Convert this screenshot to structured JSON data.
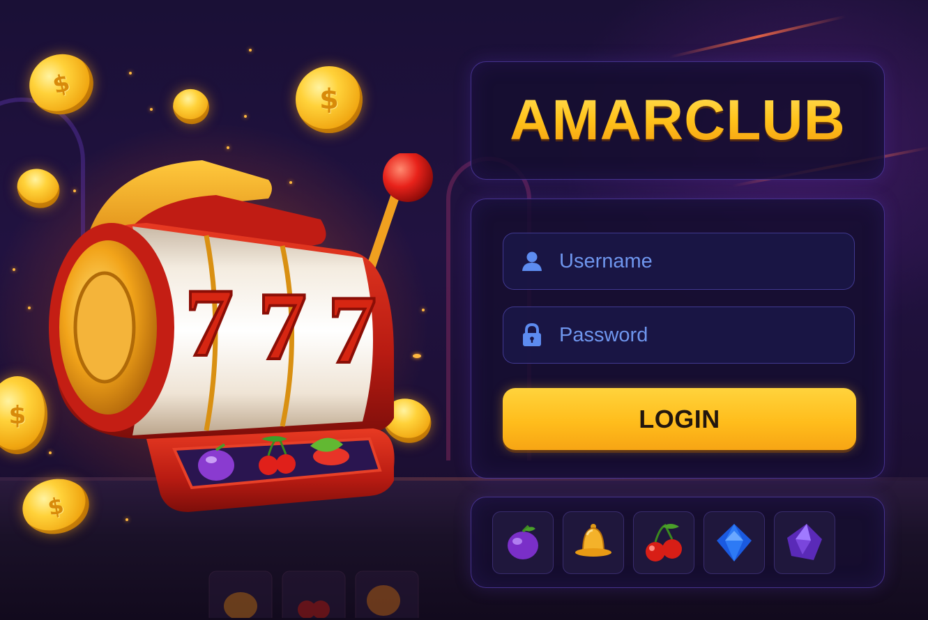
{
  "brand": {
    "title": "AMARCLUB"
  },
  "login_form": {
    "username": {
      "placeholder": "Username",
      "icon": "user-icon"
    },
    "password": {
      "placeholder": "Password",
      "icon": "lock-icon"
    },
    "submit_label": "LOGIN"
  },
  "slot_machine": {
    "reels": [
      "7",
      "7",
      "7"
    ],
    "tray_symbols": [
      "plum-icon",
      "cherries-icon",
      "leaf-icon"
    ]
  },
  "symbols": [
    {
      "name": "plum-icon"
    },
    {
      "name": "bell-icon"
    },
    {
      "name": "cherries-icon"
    },
    {
      "name": "blue-gem-icon"
    },
    {
      "name": "purple-gem-icon"
    }
  ],
  "coin_symbol": "$",
  "colors": {
    "accent_gold": "#ffc21a",
    "panel_border": "#6e50dc",
    "input_text": "#7fa6ff",
    "background": "#1c0f33"
  }
}
